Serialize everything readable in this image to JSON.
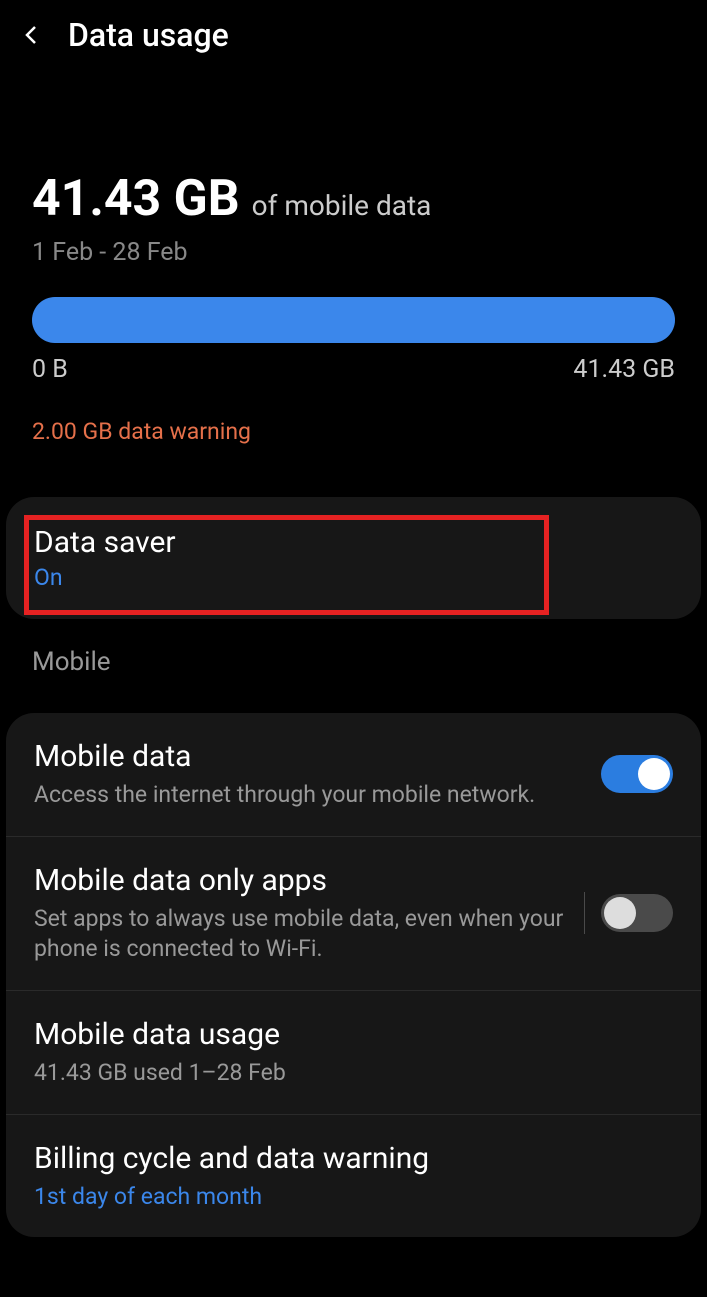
{
  "header": {
    "title": "Data usage"
  },
  "usage": {
    "amount": "41.43 GB",
    "suffix": "of mobile data",
    "period": "1 Feb - 28 Feb",
    "progress_min": "0 B",
    "progress_max": "41.43 GB",
    "warning": "2.00 GB data warning"
  },
  "data_saver": {
    "title": "Data saver",
    "status": "On"
  },
  "section_label": "Mobile",
  "mobile_data": {
    "title": "Mobile data",
    "desc": "Access the internet through your mobile network.",
    "enabled": true
  },
  "mobile_only_apps": {
    "title": "Mobile data only apps",
    "desc": "Set apps to always use mobile data, even when your phone is connected to Wi-Fi.",
    "enabled": false
  },
  "mobile_usage": {
    "title": "Mobile data usage",
    "desc": "41.43 GB used 1–28 Feb"
  },
  "billing": {
    "title": "Billing cycle and data warning",
    "desc": "1st day of each month"
  }
}
